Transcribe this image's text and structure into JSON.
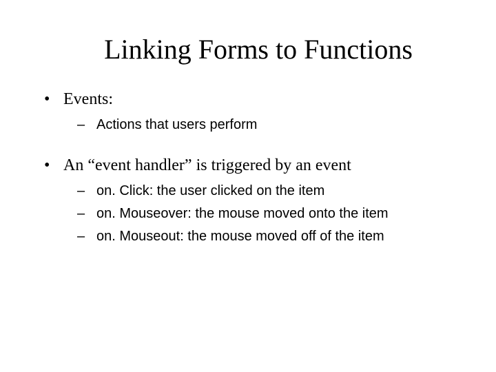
{
  "title": "Linking Forms to Functions",
  "bullets": {
    "b1": {
      "text": "Events:",
      "sub": {
        "s1": "Actions that users perform"
      }
    },
    "b2": {
      "text": "An “event handler” is triggered by an event",
      "sub": {
        "s1": "on. Click: the user clicked on the item",
        "s2": "on. Mouseover: the mouse moved onto the item",
        "s3": "on. Mouseout: the mouse moved off of the item"
      }
    }
  }
}
